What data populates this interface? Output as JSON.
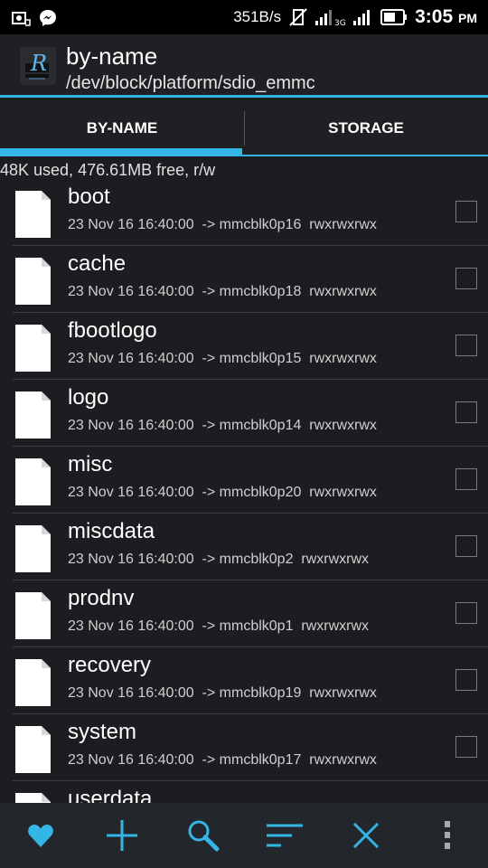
{
  "status_bar": {
    "speed": "351B/s",
    "time": "3:05",
    "ampm": "PM",
    "signal_label_1": "3G",
    "icons": [
      "screenshot-icon",
      "messenger-icon",
      "no-vibrate-icon",
      "signal-icon",
      "signal-icon",
      "battery-icon"
    ]
  },
  "app": {
    "title": "by-name",
    "subtitle": "/dev/block/platform/sdio_emmc",
    "logo_letter": "R"
  },
  "tabs": [
    {
      "label": "BY-NAME",
      "active": true
    },
    {
      "label": "STORAGE",
      "active": false
    }
  ],
  "summary": "48K used, 476.61MB free, r/w",
  "files": [
    {
      "name": "boot",
      "meta": "23 Nov 16 16:40:00  -> mmcblk0p16  rwxrwxrwx"
    },
    {
      "name": "cache",
      "meta": "23 Nov 16 16:40:00  -> mmcblk0p18  rwxrwxrwx"
    },
    {
      "name": "fbootlogo",
      "meta": "23 Nov 16 16:40:00  -> mmcblk0p15  rwxrwxrwx"
    },
    {
      "name": "logo",
      "meta": "23 Nov 16 16:40:00  -> mmcblk0p14  rwxrwxrwx"
    },
    {
      "name": "misc",
      "meta": "23 Nov 16 16:40:00  -> mmcblk0p20  rwxrwxrwx"
    },
    {
      "name": "miscdata",
      "meta": "23 Nov 16 16:40:00  -> mmcblk0p2  rwxrwxrwx"
    },
    {
      "name": "prodnv",
      "meta": "23 Nov 16 16:40:00  -> mmcblk0p1  rwxrwxrwx"
    },
    {
      "name": "recovery",
      "meta": "23 Nov 16 16:40:00  -> mmcblk0p19  rwxrwxrwx"
    },
    {
      "name": "system",
      "meta": "23 Nov 16 16:40:00  -> mmcblk0p17  rwxrwxrwx"
    },
    {
      "name": "userdata",
      "meta": ""
    }
  ],
  "toolbar": [
    "favorites-icon",
    "add-icon",
    "search-icon",
    "sort-icon",
    "close-icon",
    "overflow-menu-icon"
  ],
  "colors": {
    "accent": "#33b5e5",
    "background": "#1b1d20"
  }
}
